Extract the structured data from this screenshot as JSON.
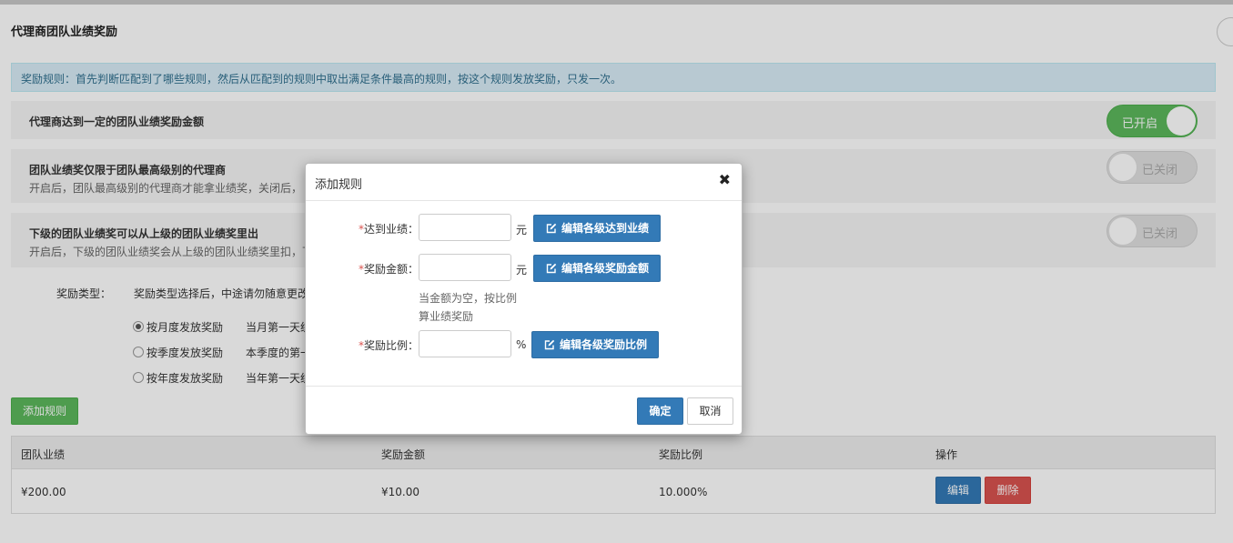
{
  "page": {
    "title": "代理商团队业绩奖励",
    "info": "奖励规则：首先判断匹配到了哪些规则，然后从匹配到的规则中取出满足条件最高的规则，按这个规则发放奖励，只发一次。"
  },
  "settings": [
    {
      "title": "代理商达到一定的团队业绩奖励金额",
      "desc": "",
      "toggle_label": "已开启",
      "enabled": true
    },
    {
      "title": "团队业绩奖仅限于团队最高级别的代理商",
      "desc": "开启后，团队最高级别的代理商才能拿业绩奖，关闭后，",
      "toggle_label": "已关闭",
      "enabled": false
    },
    {
      "title": "下级的团队业绩奖可以从上级的团队业绩奖里出",
      "desc": "开启后，下级的团队业绩奖会从上级的团队业绩奖里扣，下",
      "toggle_label": "已关闭",
      "enabled": false
    }
  ],
  "reward_type": {
    "label": "奖励类型：",
    "hint": "奖励类型选择后，中途请勿随意更改",
    "options": [
      {
        "label": "按月度发放奖励",
        "desc": "当月第一天统计",
        "checked": true
      },
      {
        "label": "按季度发放奖励",
        "desc": "本季度的第一天",
        "checked": false
      },
      {
        "label": "按年度发放奖励",
        "desc": "当年第一天统计",
        "checked": false
      }
    ]
  },
  "add_rule_label": "添加规则",
  "table": {
    "headers": [
      "团队业绩",
      "奖励金额",
      "奖励比例",
      "操作"
    ],
    "rows": [
      {
        "performance": "¥200.00",
        "amount": "¥10.00",
        "ratio": "10.000%",
        "edit": "编辑",
        "delete": "删除"
      }
    ]
  },
  "modal": {
    "title": "添加规则",
    "close": "✖",
    "fields": [
      {
        "required_mark": "*",
        "label": "达到业绩：",
        "value": "",
        "unit": "元",
        "button": "编辑各级达到业绩"
      },
      {
        "required_mark": "*",
        "label": "奖励金额：",
        "value": "",
        "unit": "元",
        "button": "编辑各级奖励金额"
      },
      {
        "required_mark": "*",
        "label": "奖励比例：",
        "value": "",
        "unit": "%",
        "button": "编辑各级奖励比例"
      }
    ],
    "help_line1": "当金额为空，按比例",
    "help_line2": "算业绩奖励",
    "ok": "确定",
    "cancel": "取消"
  },
  "colors": {
    "success": "#5cb85c",
    "primary": "#337ab7",
    "danger": "#d9534f",
    "info_bg": "#d9edf7"
  },
  "icons": {
    "modal_close": "close-icon",
    "field_button": "edit-icon"
  }
}
